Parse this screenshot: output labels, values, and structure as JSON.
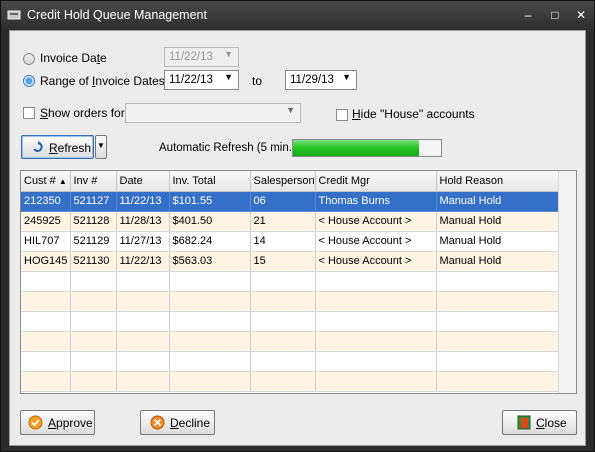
{
  "window": {
    "title": "Credit Hold Queue Management",
    "minimize": "–",
    "maximize": "□",
    "close": "✕"
  },
  "filters": {
    "invoice_date_label_pre": "Invoice Da",
    "invoice_date_label_u": "t",
    "invoice_date_label_post": "e",
    "invoice_date_value": "11/22/13",
    "range_label_pre": "Range of ",
    "range_label_u": "I",
    "range_label_post": "nvoice Dates",
    "range_from": "11/22/13",
    "to_label": "to",
    "range_to": "11/29/13",
    "show_orders_u": "S",
    "show_orders_post": "how orders for:",
    "show_orders_value": "",
    "hide_house_u": "H",
    "hide_house_post": "ide \"House\" accounts"
  },
  "toolbar": {
    "refresh_u": "R",
    "refresh_post": "efresh",
    "auto_refresh_label": "Automatic Refresh (5 min.)",
    "auto_refresh_progress": 0.85
  },
  "grid": {
    "columns": [
      "Cust #",
      "Inv #",
      "Date",
      "Inv. Total",
      "Salesperson",
      "Credit Mgr",
      "Hold Reason"
    ],
    "sort_indicator": "▲",
    "rows": [
      [
        "212350",
        "521127",
        "11/22/13",
        "$101.55",
        "06",
        "Thomas Burns",
        "Manual Hold"
      ],
      [
        "245925",
        "521128",
        "11/28/13",
        "$401.50",
        "21",
        "< House Account >",
        "Manual Hold"
      ],
      [
        "HIL707",
        "521129",
        "11/27/13",
        "$682.24",
        "14",
        "< House Account >",
        "Manual Hold"
      ],
      [
        "HOG145",
        "521130",
        "11/22/13",
        "$563.03",
        "15",
        "< House Account >",
        "Manual Hold"
      ]
    ],
    "selected_row": 0,
    "empty_rows": 6
  },
  "footer": {
    "approve_u": "A",
    "approve_post": "pprove",
    "decline_u": "D",
    "decline_post": "ecline",
    "close_u": "C",
    "close_post": "lose"
  },
  "colors": {
    "selection": "#3470c8",
    "progress": "#22c422",
    "alt_row": "#fdf3e3"
  }
}
